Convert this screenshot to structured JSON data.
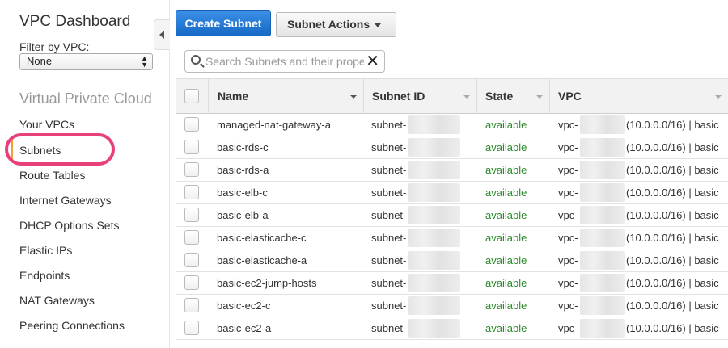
{
  "sidebar": {
    "title": "VPC Dashboard",
    "filter_label": "Filter by VPC:",
    "filter_value": "None",
    "section_title": "Virtual Private Cloud",
    "items": [
      {
        "label": "Your VPCs"
      },
      {
        "label": "Subnets",
        "active": true
      },
      {
        "label": "Route Tables"
      },
      {
        "label": "Internet Gateways"
      },
      {
        "label": "DHCP Options Sets"
      },
      {
        "label": "Elastic IPs"
      },
      {
        "label": "Endpoints"
      },
      {
        "label": "NAT Gateways"
      },
      {
        "label": "Peering Connections"
      }
    ]
  },
  "toolbar": {
    "create_label": "Create Subnet",
    "actions_label": "Subnet Actions"
  },
  "search": {
    "placeholder": "Search Subnets and their properties",
    "clear_icon": "close-icon"
  },
  "table": {
    "columns": [
      "Name",
      "Subnet ID",
      "State",
      "VPC"
    ],
    "rows": [
      {
        "name": "managed-nat-gateway-a",
        "subnet_id": "subnet-",
        "state": "available",
        "vpc_prefix": "vpc-",
        "vpc_suffix": "(10.0.0.0/16) | basic"
      },
      {
        "name": "basic-rds-c",
        "subnet_id": "subnet-",
        "state": "available",
        "vpc_prefix": "vpc-",
        "vpc_suffix": "(10.0.0.0/16) | basic"
      },
      {
        "name": "basic-rds-a",
        "subnet_id": "subnet-",
        "state": "available",
        "vpc_prefix": "vpc-",
        "vpc_suffix": "(10.0.0.0/16) | basic"
      },
      {
        "name": "basic-elb-c",
        "subnet_id": "subnet-",
        "state": "available",
        "vpc_prefix": "vpc-",
        "vpc_suffix": "(10.0.0.0/16) | basic"
      },
      {
        "name": "basic-elb-a",
        "subnet_id": "subnet-",
        "state": "available",
        "vpc_prefix": "vpc-",
        "vpc_suffix": "(10.0.0.0/16) | basic"
      },
      {
        "name": "basic-elasticache-c",
        "subnet_id": "subnet-",
        "state": "available",
        "vpc_prefix": "vpc-",
        "vpc_suffix": "(10.0.0.0/16) | basic"
      },
      {
        "name": "basic-elasticache-a",
        "subnet_id": "subnet-",
        "state": "available",
        "vpc_prefix": "vpc-",
        "vpc_suffix": "(10.0.0.0/16) | basic"
      },
      {
        "name": "basic-ec2-jump-hosts",
        "subnet_id": "subnet-",
        "state": "available",
        "vpc_prefix": "vpc-",
        "vpc_suffix": "(10.0.0.0/16) | basic"
      },
      {
        "name": "basic-ec2-c",
        "subnet_id": "subnet-",
        "state": "available",
        "vpc_prefix": "vpc-",
        "vpc_suffix": "(10.0.0.0/16) | basic"
      },
      {
        "name": "basic-ec2-a",
        "subnet_id": "subnet-",
        "state": "available",
        "vpc_prefix": "vpc-",
        "vpc_suffix": "(10.0.0.0/16) | basic"
      }
    ]
  },
  "colors": {
    "primary_button": "#1669c4",
    "state_available": "#2a8a2a",
    "active_indicator": "#f0a030",
    "highlight_circle": "#e8407a"
  }
}
